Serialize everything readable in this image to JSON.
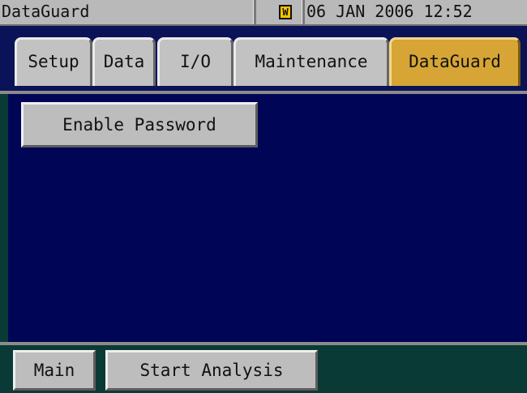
{
  "titlebar": {
    "title": "DataGuard",
    "status_icon": "warning-icon",
    "status_icon_glyph": "W",
    "datetime": "06 JAN 2006 12:52"
  },
  "tabs": [
    {
      "label": "Setup",
      "active": false
    },
    {
      "label": "Data",
      "active": false
    },
    {
      "label": "I/O",
      "active": false
    },
    {
      "label": "Maintenance",
      "active": false
    },
    {
      "label": "DataGuard",
      "active": true
    }
  ],
  "main": {
    "enable_password_label": "Enable Password"
  },
  "footer": {
    "main_label": "Main",
    "start_analysis_label": "Start Analysis"
  },
  "colors": {
    "active_tab": "#d6a535",
    "panel_bg": "#000655",
    "footer_bg": "#0a3a35"
  }
}
